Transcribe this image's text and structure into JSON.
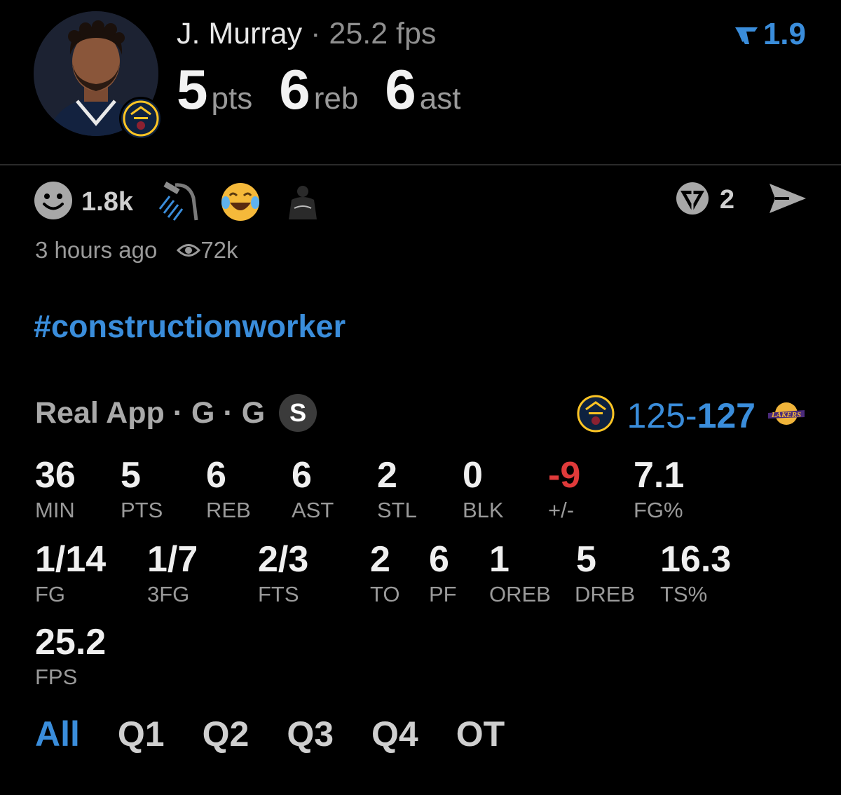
{
  "header": {
    "player_name": "J. Murray",
    "separator": "·",
    "fps_text": "25.2 fps",
    "rating": "1.9",
    "big_stats": [
      {
        "value": "5",
        "unit": "pts"
      },
      {
        "value": "6",
        "unit": "reb"
      },
      {
        "value": "6",
        "unit": "ast"
      }
    ]
  },
  "reactions": {
    "count": "1.8k",
    "emojis": [
      "smiley-icon",
      "shower-icon",
      "laughing-emoji",
      "brooklyn-jersey-icon"
    ],
    "reply_count": "2"
  },
  "meta": {
    "time_ago": "3 hours ago",
    "views": "72k"
  },
  "post": {
    "hashtag": "#constructionworker"
  },
  "game": {
    "label_app": "Real App",
    "label_sep1": "·",
    "label_g1": "G",
    "label_sep2": "·",
    "label_g2": "G",
    "badge": "S",
    "score_home": "125",
    "score_dash": "-",
    "score_away": "127"
  },
  "stats": {
    "row1": [
      {
        "value": "36",
        "label": "MIN"
      },
      {
        "value": "5",
        "label": "PTS"
      },
      {
        "value": "6",
        "label": "REB"
      },
      {
        "value": "6",
        "label": "AST"
      },
      {
        "value": "2",
        "label": "STL"
      },
      {
        "value": "0",
        "label": "BLK"
      },
      {
        "value": "-9",
        "label": "+/-"
      },
      {
        "value": "7.1",
        "label": "FG%"
      }
    ],
    "row2": [
      {
        "value": "1/14",
        "label": "FG"
      },
      {
        "value": "1/7",
        "label": "3FG"
      },
      {
        "value": "2/3",
        "label": "FTS"
      },
      {
        "value": "2",
        "label": "TO"
      },
      {
        "value": "6",
        "label": "PF"
      },
      {
        "value": "1",
        "label": "OREB"
      },
      {
        "value": "5",
        "label": "DREB"
      },
      {
        "value": "16.3",
        "label": "TS%"
      }
    ],
    "row3": [
      {
        "value": "25.2",
        "label": "FPS"
      }
    ]
  },
  "tabs": [
    "All",
    "Q1",
    "Q2",
    "Q3",
    "Q4",
    "OT"
  ],
  "colors": {
    "accent": "#3a8ddb",
    "negative": "#e03a3a",
    "background": "#000000"
  }
}
